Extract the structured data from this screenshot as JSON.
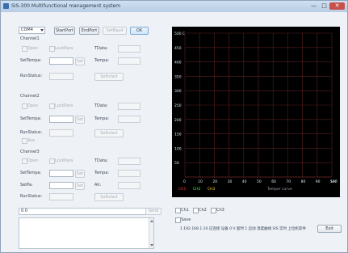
{
  "window": {
    "title": "SIS-300 Multifunctional management system",
    "min": "—",
    "max": "□",
    "close": "✕"
  },
  "toolbar": {
    "port_value": "COM4",
    "startport_label": "StartPort",
    "endport_label": "EndPort",
    "setbaud_label": "SetBaud",
    "ok_label": "OK"
  },
  "channels": [
    {
      "label": "Channel1",
      "open_label": "Open",
      "lockpara_label": "LockPara",
      "tdata_label": "TData:",
      "settempa_label": "SetTempa:",
      "set_label": "Set",
      "tempa_label": "Tempa:",
      "runstatus_label": "RunStatus:",
      "softstart_label": "Softstart"
    },
    {
      "label": "Channel2",
      "open_label": "Open",
      "lockpara_label": "LockPara",
      "tdata_label": "TData:",
      "settempa_label": "SetTempa:",
      "set_label": "Set",
      "tempa_label": "Tempa:",
      "runstatus_label": "RunStatus:",
      "softstart_label": "Softstart",
      "extra_checkbox_label": "Ave"
    },
    {
      "label": "Channel3",
      "open_label": "Open",
      "lockpara_label": "LockPara",
      "tdata_label": "TData:",
      "settempa_label": "SetTempa:",
      "set_label": "Set",
      "tempa_label": "Tempa:",
      "setpa_label": "SetPa:",
      "ah_label": "Ah:",
      "runstatus_label": "RunStatus:",
      "softstart_label": "Softstart"
    }
  ],
  "bottom": {
    "input_value": "0.0",
    "send_label": "Send",
    "ch_checkbox_labels": [
      "Ch1",
      "Ch2",
      "Ch3"
    ],
    "save_checkbox_label": "Save",
    "status_text": "1.192.168.1.10 已连接 设备 0 V 超时 1 启动 温度曲线 SIS 实时 上位机软件",
    "exit_label": "Exit"
  },
  "chart_data": {
    "type": "line",
    "ylabel_top": "500 C",
    "yticks": [
      "500 C",
      "450",
      "400",
      "350",
      "300",
      "250",
      "200",
      "150",
      "100",
      "50"
    ],
    "xticks": [
      "0",
      "10",
      "20",
      "30",
      "40",
      "50",
      "60",
      "70",
      "80",
      "90",
      "100",
      "Sec"
    ],
    "ylim": [
      0,
      500
    ],
    "xlim": [
      0,
      100
    ],
    "grid": true,
    "grid_color": "#5a2020",
    "background": "#000000",
    "legend": [
      {
        "name": "CH1",
        "color": "#ff3b3b"
      },
      {
        "name": "CH2",
        "color": "#3bff5a"
      },
      {
        "name": "CH3",
        "color": "#ffd23b"
      }
    ],
    "caption": "Temper curve",
    "series": []
  }
}
